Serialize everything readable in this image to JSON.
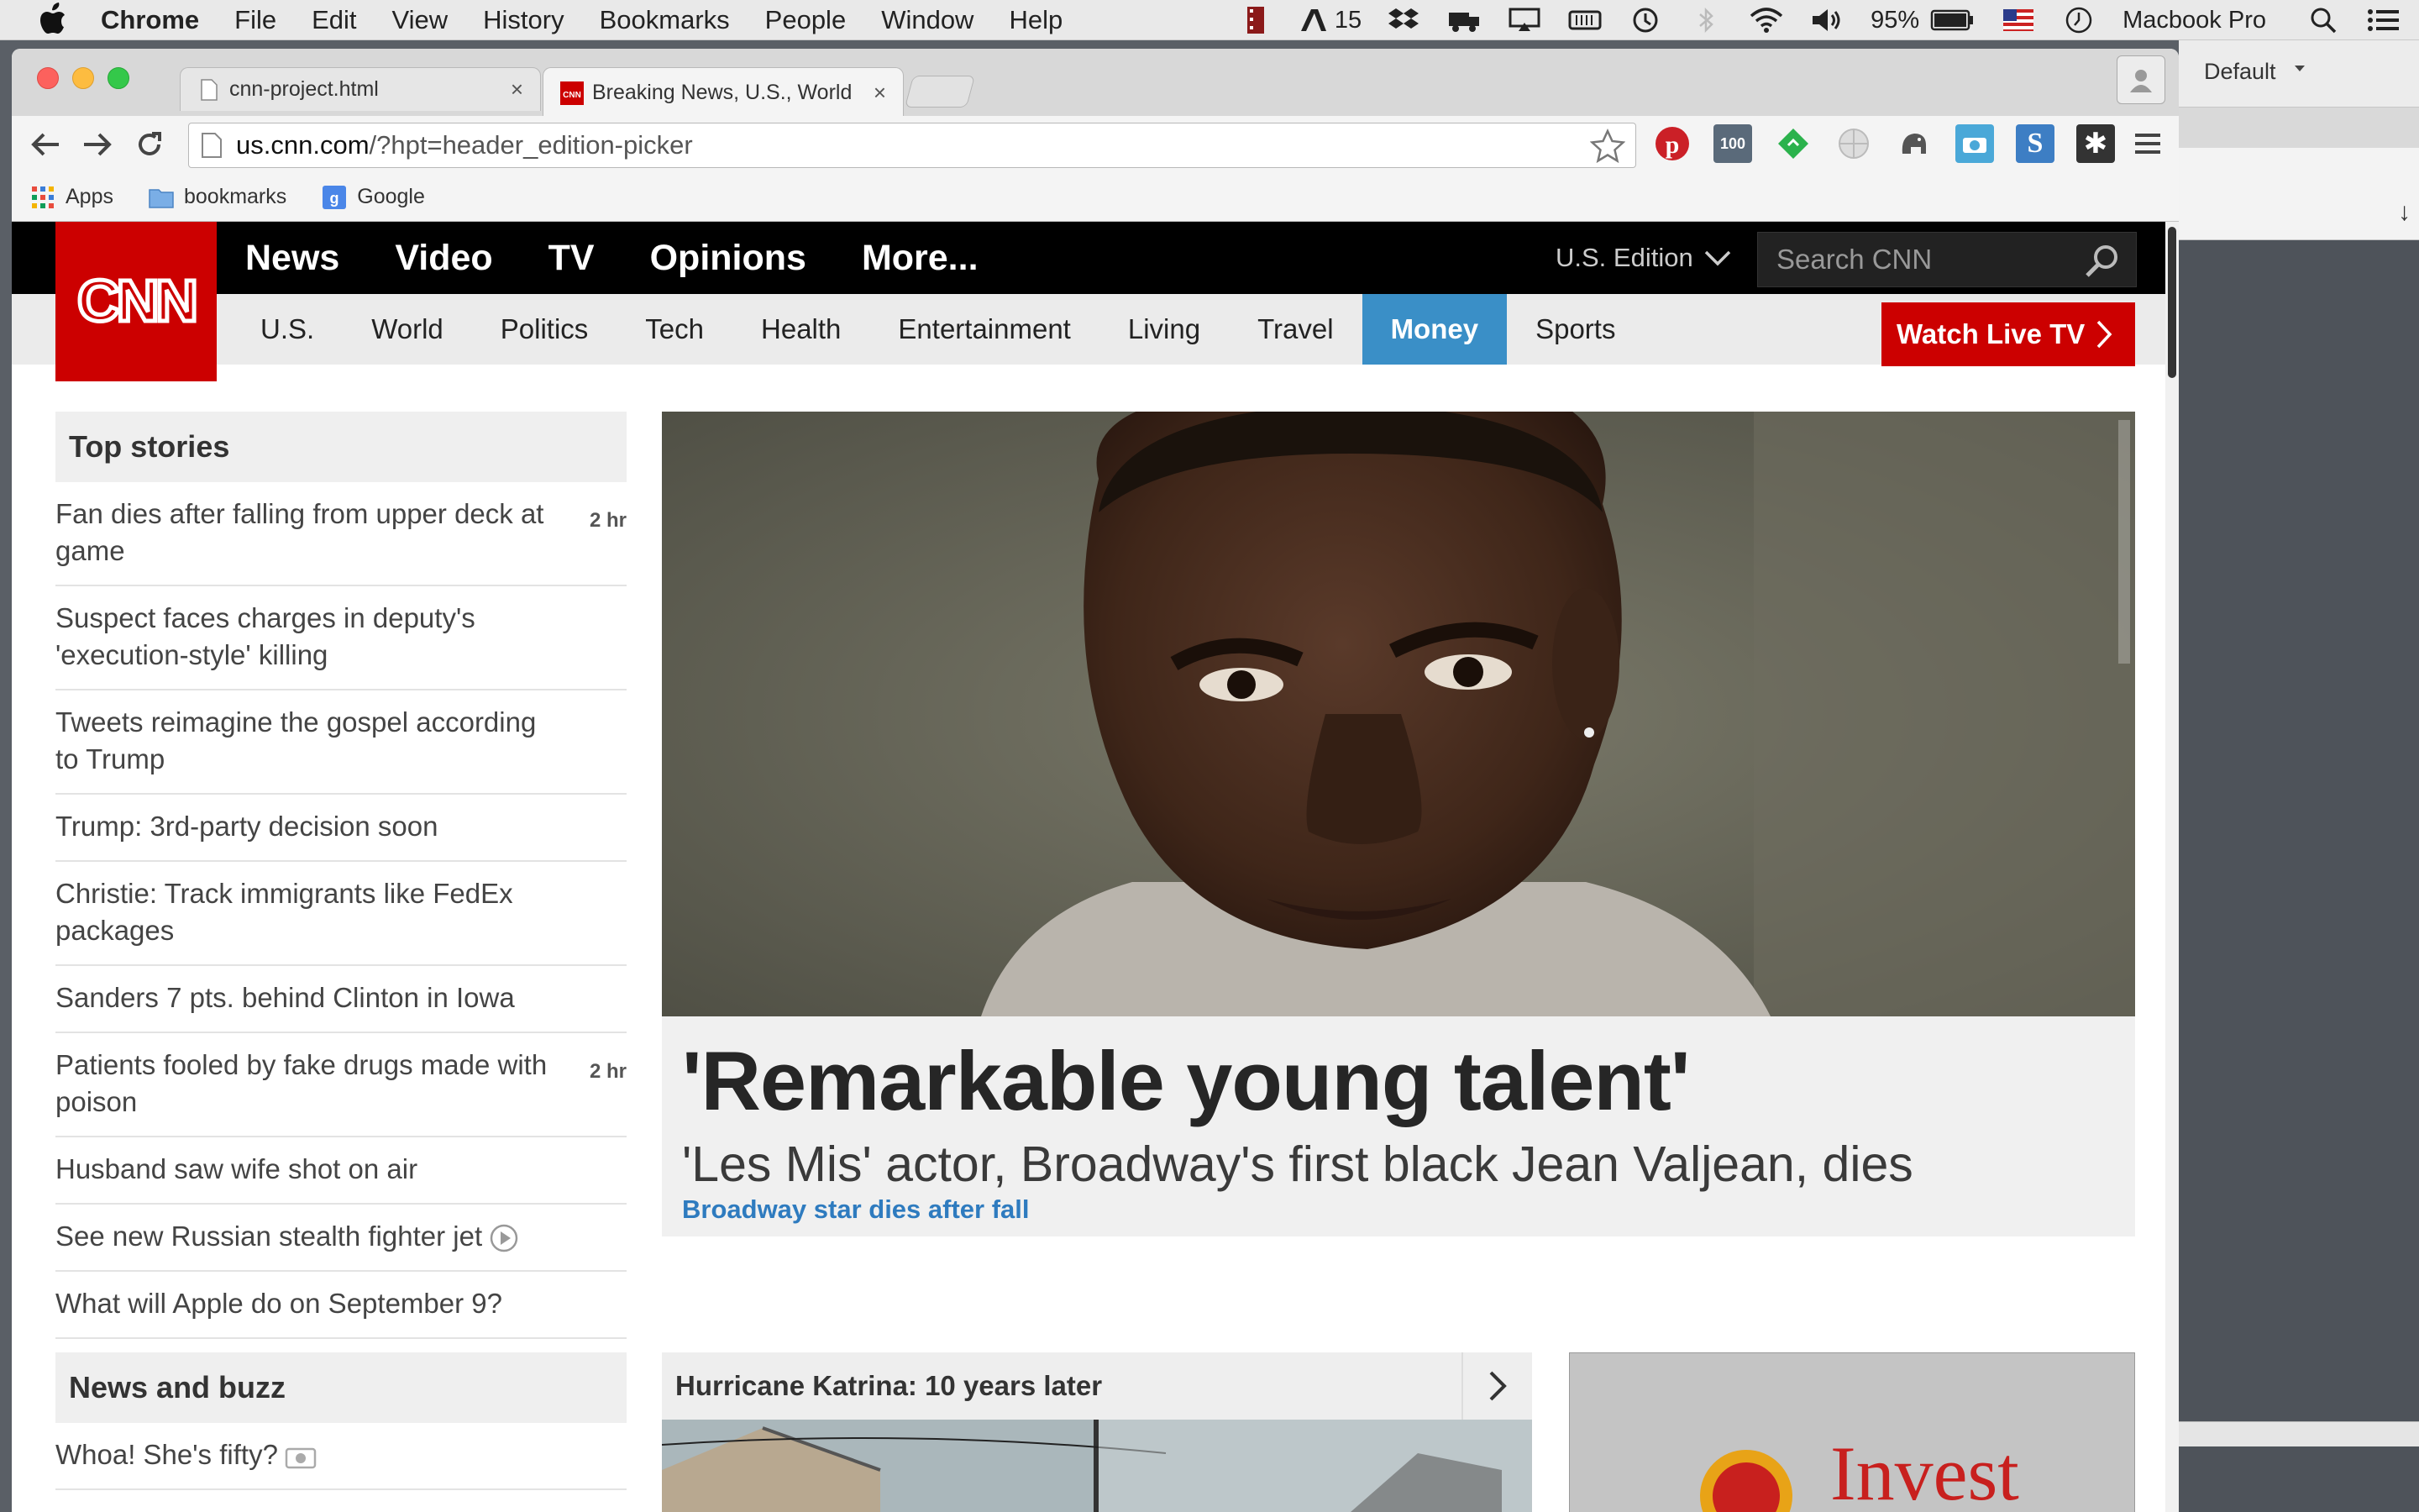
{
  "menubar": {
    "app": "Chrome",
    "items": [
      "File",
      "Edit",
      "View",
      "History",
      "Bookmarks",
      "People",
      "Window",
      "Help"
    ],
    "adobe_count": "15",
    "battery": "95%",
    "user": "Macbook Pro"
  },
  "other_window": {
    "profile_label": "Default"
  },
  "browser": {
    "tabs": [
      {
        "title": "cnn-project.html",
        "close": "×"
      },
      {
        "title": "Breaking News, U.S., World",
        "close": "×"
      }
    ],
    "url_host": "us.cnn.com",
    "url_rest": "/?hpt=header_edition-picker",
    "bookmarks": [
      "Apps",
      "bookmarks",
      "Google"
    ],
    "extensions": [
      "pinterest-icon",
      "counter-100-icon",
      "feedly-icon",
      "globe-icon",
      "elephant-icon",
      "camera-icon",
      "s-icon",
      "asterisk-icon"
    ]
  },
  "cnn": {
    "logo": "CNN",
    "main_nav": [
      "News",
      "Video",
      "TV",
      "Opinions",
      "More..."
    ],
    "edition": "U.S. Edition",
    "search_placeholder": "Search CNN",
    "sub_nav": [
      "U.S.",
      "World",
      "Politics",
      "Tech",
      "Health",
      "Entertainment",
      "Living",
      "Travel",
      "Money",
      "Sports"
    ],
    "sub_nav_active": "Money",
    "watch_live": "Watch Live TV",
    "top_stories_title": "Top stories",
    "top_stories": [
      {
        "text": "Fan dies after falling from upper deck at game",
        "age": "2 hr"
      },
      {
        "text": "Suspect faces charges in deputy's 'execution-style' killing",
        "age": ""
      },
      {
        "text": "Tweets reimagine the gospel according to Trump",
        "age": ""
      },
      {
        "text": "Trump: 3rd-party decision soon",
        "age": ""
      },
      {
        "text": "Christie: Track immigrants like FedEx packages",
        "age": ""
      },
      {
        "text": "Sanders 7 pts. behind Clinton in Iowa",
        "age": ""
      },
      {
        "text": "Patients fooled by fake drugs made with poison",
        "age": "2 hr"
      },
      {
        "text": "Husband saw wife shot on air",
        "age": ""
      },
      {
        "text": "See new Russian stealth fighter jet",
        "age": "",
        "media": "play"
      },
      {
        "text": "What will Apple do on September 9?",
        "age": ""
      }
    ],
    "news_buzz_title": "News and buzz",
    "news_buzz": [
      {
        "text": "Whoa! She's fifty?",
        "media": "camera"
      }
    ],
    "hero": {
      "title": "'Remarkable young talent'",
      "subtitle": "'Les Mis' actor, Broadway's first black Jean Valjean, dies",
      "link": "Broadway star dies after fall"
    },
    "katrina_title": "Hurricane Katrina: 10 years later",
    "ad_text": "Invest"
  }
}
